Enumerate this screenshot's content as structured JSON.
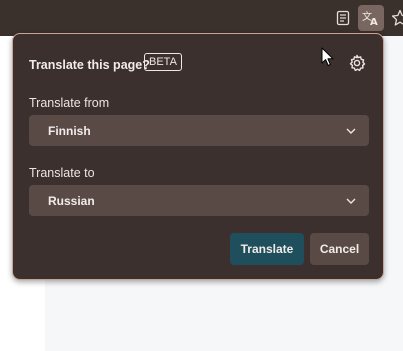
{
  "toolbar": {
    "icons": [
      "reader-view-icon",
      "translate-icon",
      "star-icon"
    ]
  },
  "popup": {
    "title": "Translate this page?",
    "badge": "BETA",
    "settings_icon": "gear-icon",
    "from": {
      "label": "Translate from",
      "value": "Finnish"
    },
    "to": {
      "label": "Translate to",
      "value": "Russian"
    },
    "buttons": {
      "translate": "Translate",
      "cancel": "Cancel"
    }
  },
  "colors": {
    "popup_bg": "#3b302d",
    "popup_border": "#c9a495",
    "select_bg": "#5a4a46",
    "primary_button": "#1f4f5c",
    "toolbar_bg": "#3a302c"
  }
}
